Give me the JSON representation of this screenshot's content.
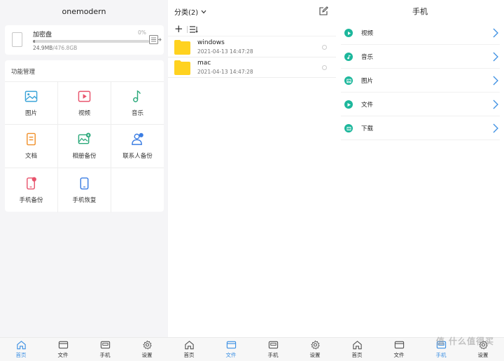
{
  "panel1": {
    "title": "onemodern",
    "disk": {
      "name": "加密盘",
      "percent_label": "0%",
      "percent_value": 0.0,
      "used": "24.9MB",
      "total": "/476.8GB"
    },
    "func_title": "功能管理",
    "func_items": [
      {
        "label": "图片",
        "icon": "image-icon"
      },
      {
        "label": "视频",
        "icon": "video-icon"
      },
      {
        "label": "音乐",
        "icon": "music-icon"
      },
      {
        "label": "文档",
        "icon": "document-icon"
      },
      {
        "label": "相册备份",
        "icon": "album-backup-icon"
      },
      {
        "label": "联系人备份",
        "icon": "contacts-backup-icon"
      },
      {
        "label": "手机备份",
        "icon": "phone-backup-icon"
      },
      {
        "label": "手机恢复",
        "icon": "phone-restore-icon"
      }
    ]
  },
  "panel2": {
    "title": "分类(2)",
    "files": [
      {
        "name": "windows",
        "date": "2021-04-13 14:47:28"
      },
      {
        "name": "mac",
        "date": "2021-04-13 14:47:28"
      }
    ]
  },
  "panel3": {
    "title": "手机",
    "items": [
      {
        "label": "视频",
        "icon": "video-icon"
      },
      {
        "label": "音乐",
        "icon": "music-icon"
      },
      {
        "label": "图片",
        "icon": "image-icon"
      },
      {
        "label": "文件",
        "icon": "file-icon"
      },
      {
        "label": "下载",
        "icon": "download-icon"
      }
    ],
    "watermark": "值 什么值得买"
  },
  "nav": [
    "首页",
    "文件",
    "手机",
    "设置"
  ],
  "colors": {
    "accent": "#3b8fe3",
    "teal": "#1db79c",
    "folder": "#ffd21f"
  }
}
